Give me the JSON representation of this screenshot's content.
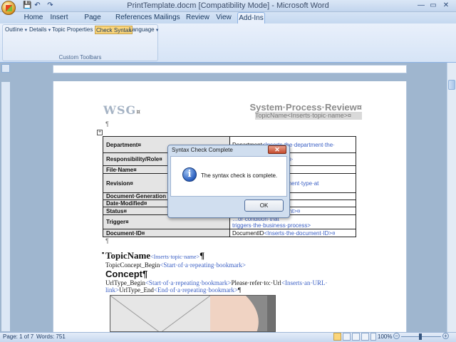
{
  "window": {
    "title": "PrintTemplate.docm [Compatibility Mode] - Microsoft Word",
    "controls": {
      "minimize": "—",
      "maximize": "▭",
      "close": "✕"
    }
  },
  "quick_access": {
    "save": "💾",
    "undo": "↶",
    "redo": "↷"
  },
  "tabs": [
    "Home",
    "Insert",
    "Page Layout",
    "References",
    "Mailings",
    "Review",
    "View",
    "Add-Ins"
  ],
  "active_tab": "Add-Ins",
  "ribbon": {
    "buttons": [
      "Outline",
      "Details",
      "Topic Properties",
      "Check Syntax",
      "Language"
    ],
    "group_label": "Custom Toolbars"
  },
  "document": {
    "logo": "WSG",
    "logo_mark": "¤",
    "heading": "System·Process·Review¤",
    "topic_field": "TopicName<Inserts·topic·name>¤",
    "table": [
      {
        "label": "Department¤",
        "prefix": "",
        "code": "Department",
        "value": "<Inserts·the·department·the·"
      },
      {
        "label": "Responsibility/Role¤",
        "prefix": "",
        "code": "",
        "value": "…roles·assigned·to·the·"
      },
      {
        "label": "File·Name¤",
        "prefix": "",
        "code": "",
        "value": ""
      },
      {
        "label": "Revision¤",
        "prefix": "",
        "code": "",
        "value": "…version·number ·…ment·type·at"
      },
      {
        "label": "Document·Generation",
        "prefix": "",
        "code": "",
        "value": ""
      },
      {
        "label": "Date·Modified¤",
        "prefix": "",
        "code": "",
        "value": "¤"
      },
      {
        "label": "Status¤",
        "prefix": "",
        "code": "",
        "value": "…tatus·of·the·document>¤"
      },
      {
        "label": "Trigger¤",
        "prefix": "",
        "code": "",
        "value": "…or·condition·that triggers·the·business·process>"
      },
      {
        "label": "Document·ID¤",
        "prefix": "",
        "code": "DocumentID",
        "value": "<Inserts·the·document·ID>¤"
      }
    ],
    "lines": {
      "topicname_code": "TopicName",
      "topicname_hint": "<Inserts·topic·name>",
      "topicname_mark": "¶",
      "topicconcept_code": "TopicConcept_Begin",
      "topicconcept_hint": "<Start·of·a·repeating·bookmark>",
      "concept_heading": "Concept¶",
      "urltype_code": "UrlType_Begin",
      "urltype_hint": "<Start·of·a·repeating·bookmark>",
      "refer_text": "Please·refer·to:·",
      "url_code": "Url",
      "url_hint": "<Inserts·an·URL·",
      "link_text": "link>",
      "urltype_end_code": "UrlType_End",
      "urltype_end_hint": "<End·of·a·repeating·bookmark>",
      "end_mark": "¶"
    }
  },
  "dialog": {
    "title": "Syntax Check Complete",
    "close": "✕",
    "icon": "i",
    "message": "The syntax check is complete.",
    "ok_label": "OK"
  },
  "status": {
    "page": "Page: 1 of 7",
    "words": "Words: 751",
    "zoom": "100%"
  },
  "colors": {
    "accent": "#3a5fc4",
    "ribbon": "#dfe9f7",
    "pressed": "#fbd57a"
  }
}
